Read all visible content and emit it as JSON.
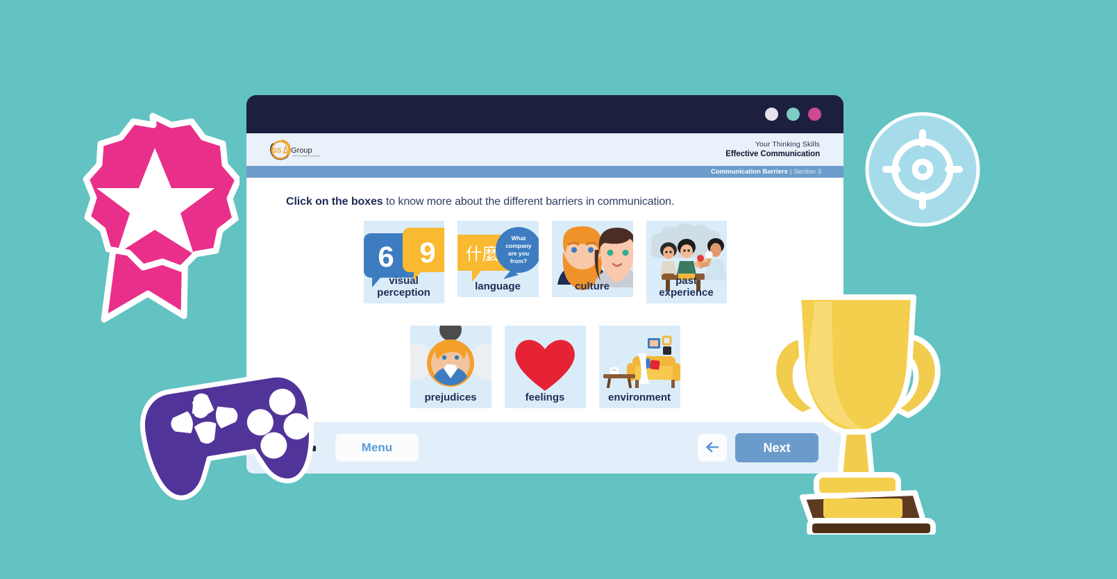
{
  "background": {
    "color": "#63c2c2"
  },
  "window": {
    "titlebar": {
      "dots": [
        {
          "name": "window-dot-1",
          "color": "#e6e3ef"
        },
        {
          "name": "window-dot-2",
          "color": "#7dccc6"
        },
        {
          "name": "window-dot-3",
          "color": "#cc4a90"
        }
      ]
    },
    "header": {
      "logo_text": "SSA",
      "logo_word": "Group",
      "logo_sub": "INTERNATIONAL",
      "course_label": "Your Thinking Skills",
      "course_title": "Effective Communication"
    },
    "breadcrumb": {
      "section": "Communication Barriers",
      "separator": "|",
      "subsection": "Section 3"
    },
    "stage": {
      "instruction_bold": "Click on the boxes",
      "instruction_rest": " to know more about the different barriers in communication.",
      "cards_row1": [
        {
          "id": "visual-perception",
          "label": "visual\nperception",
          "art": "six-nine-bubbles"
        },
        {
          "id": "language",
          "label": "language",
          "art": "language-bubbles",
          "bubble_yellow_text": "什麼?",
          "bubble_blue_text": "What company are you from?"
        },
        {
          "id": "culture",
          "label": "culture",
          "art": "two-people-faces"
        },
        {
          "id": "past-experience",
          "label": "past\nexperience",
          "art": "children-ice-cream"
        }
      ],
      "cards_row2": [
        {
          "id": "prejudices",
          "label": "prejudices",
          "art": "avatar-circle"
        },
        {
          "id": "feelings",
          "label": "feelings",
          "art": "red-heart"
        },
        {
          "id": "environment",
          "label": "environment",
          "art": "living-room-sofa"
        }
      ]
    },
    "footer": {
      "menu_label": "Menu",
      "back_label": "←",
      "next_label": "Next"
    }
  },
  "decorations": {
    "rosette": {
      "name": "award-rosette",
      "color": "#e8308a"
    },
    "target": {
      "name": "target-crosshair",
      "color": "#a6dcea"
    },
    "controller": {
      "name": "game-controller",
      "color": "#51349a"
    },
    "trophy": {
      "name": "trophy",
      "color": "#f4cf4e"
    }
  }
}
